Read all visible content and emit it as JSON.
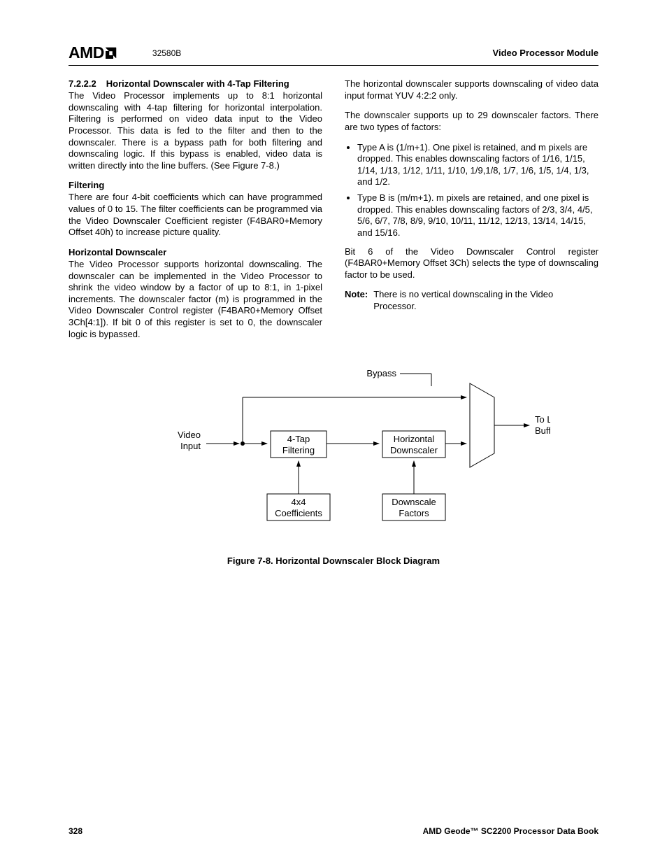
{
  "header": {
    "logo_text": "AMD",
    "doc_id": "32580B",
    "right": "Video Processor Module"
  },
  "left_col": {
    "sec_num": "7.2.2.2",
    "sec_title": "Horizontal Downscaler with 4-Tap Filtering",
    "intro": "The Video Processor implements up to 8:1 horizontal downscaling with 4-tap filtering for horizontal interpolation. Filtering is performed on video data input to the Video Processor. This data is fed to the filter and then to the downscaler. There is a bypass path for both filtering and downscaling logic. If this bypass is enabled, video data is written directly into the line buffers. (See Figure 7-8.)",
    "filtering_h": "Filtering",
    "filtering_p": "There are four 4-bit coefficients which can have programmed values of 0 to 15. The filter coefficients can be programmed via the Video Downscaler Coefficient register (F4BAR0+Memory Offset 40h) to increase picture quality.",
    "hds_h": "Horizontal Downscaler",
    "hds_p": "The Video Processor supports horizontal downscaling. The downscaler can be implemented in the Video Processor to shrink the video window by a factor of up to 8:1, in 1-pixel increments. The downscaler factor (m) is programmed in the Video Downscaler Control register (F4BAR0+Memory Offset 3Ch[4:1]). If bit 0 of this register is set to 0, the downscaler logic is bypassed."
  },
  "right_col": {
    "p1": "The horizontal downscaler supports downscaling of video data input format YUV 4:2:2 only.",
    "p2": "The downscaler supports up to 29 downscaler factors. There are two types of factors:",
    "bullets": [
      "Type A is (1/m+1). One pixel is retained, and m pixels are dropped. This enables downscaling factors of 1/16, 1/15, 1/14, 1/13, 1/12, 1/11, 1/10, 1/9,1/8, 1/7, 1/6, 1/5, 1/4, 1/3, and 1/2.",
      "Type B is (m/m+1). m pixels are retained, and one pixel is dropped. This enables downscaling factors of 2/3, 3/4, 4/5, 5/6, 6/7, 7/8, 8/9, 9/10, 10/11, 11/12, 12/13, 13/14, 14/15, and 15/16."
    ],
    "p3": "Bit 6 of the Video Downscaler Control register (F4BAR0+Memory Offset 3Ch) selects the type of downscaling factor to be used.",
    "note_label": "Note:",
    "note_text": "There is no vertical downscaling in the Video Processor."
  },
  "diagram": {
    "bypass": "Bypass",
    "video_input_l1": "Video",
    "video_input_l2": "Input",
    "tap_l1": "4-Tap",
    "tap_l2": "Filtering",
    "hd_l1": "Horizontal",
    "hd_l2": "Downscaler",
    "coef_l1": "4x4",
    "coef_l2": "Coefficients",
    "df_l1": "Downscale",
    "df_l2": "Factors",
    "out_l1": "To Line",
    "out_l2": "Buffers",
    "caption": "Figure 7-8.  Horizontal Downscaler Block Diagram"
  },
  "footer": {
    "page": "328",
    "book": "AMD Geode™ SC2200  Processor Data Book"
  }
}
